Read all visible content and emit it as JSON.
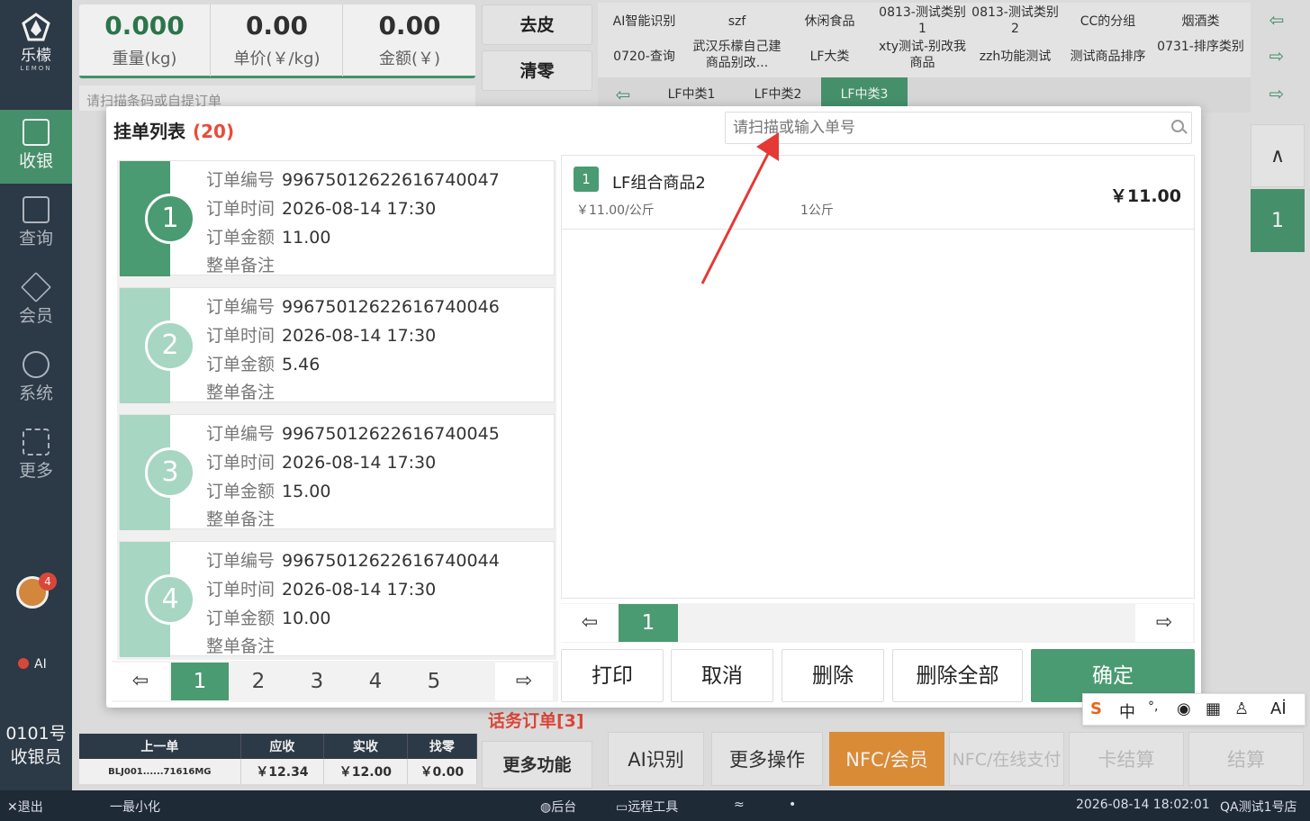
{
  "sidebar": {
    "logo_cn": "乐檬",
    "logo_en": "LEMON",
    "items": [
      {
        "label": "收银",
        "icon": "register-icon"
      },
      {
        "label": "查询",
        "icon": "search-doc-icon"
      },
      {
        "label": "会员",
        "icon": "diamond-icon"
      },
      {
        "label": "系统",
        "icon": "gear-icon"
      },
      {
        "label": "更多",
        "icon": "grid-icon"
      }
    ],
    "notification_count": "4",
    "ai_label": "AI",
    "cashier_line1": "0101号",
    "cashier_line2": "收银员"
  },
  "scale": {
    "weight_value": "0.000",
    "weight_label": "重量(kg)",
    "unit_price_value": "0.00",
    "unit_price_label": "单价(￥/kg)",
    "amount_value": "0.00",
    "amount_label": "金额(￥)"
  },
  "scan_hint": "请扫描条码或自提订单",
  "tools": {
    "tare": "去皮",
    "zero": "清零"
  },
  "categories": {
    "row1": [
      "AI智能识别",
      "szf",
      "休闲食品",
      "0813-测试类别1",
      "0813-测试类别2",
      "CC的分组",
      "烟酒类"
    ],
    "row2": [
      "0720-查询",
      "武汉乐檬自己建商品别改...",
      "LF大类",
      "xty测试-别改我商品",
      "zzh功能测试",
      "测试商品排序",
      "0731-排序类别"
    ],
    "sub": [
      "LF中类1",
      "LF中类2",
      "LF中类3"
    ],
    "active_sub": "LF中类3"
  },
  "right_page": "1",
  "modal": {
    "title": "挂单列表",
    "count": "(20)",
    "search_placeholder": "请扫描或输入单号",
    "labels": {
      "order_no": "订单编号",
      "order_time": "订单时间",
      "order_amount": "订单金额",
      "remark": "整单备注"
    },
    "orders": [
      {
        "index": "1",
        "no": "99675012622616740047",
        "time": "2026-08-14 17:30",
        "amount": "11.00"
      },
      {
        "index": "2",
        "no": "99675012622616740046",
        "time": "2026-08-14 17:30",
        "amount": "5.46"
      },
      {
        "index": "3",
        "no": "99675012622616740045",
        "time": "2026-08-14 17:30",
        "amount": "15.00"
      },
      {
        "index": "4",
        "no": "99675012622616740044",
        "time": "2026-08-14 17:30",
        "amount": "10.00"
      }
    ],
    "pages": [
      "1",
      "2",
      "3",
      "4",
      "5"
    ],
    "detail": {
      "index": "1",
      "name": "LF组合商品2",
      "unit_price": "￥11.00/公斤",
      "qty": "1公斤",
      "total": "￥11.00",
      "page": "1"
    },
    "actions": {
      "print": "打印",
      "cancel": "取消",
      "delete": "删除",
      "delete_all": "删除全部",
      "confirm": "确定"
    }
  },
  "summary": {
    "headers": [
      "上一单",
      "应收",
      "实收",
      "找零"
    ],
    "values": [
      "BLJ001......71616MG",
      "￥12.34",
      "￥12.00",
      "￥0.00"
    ]
  },
  "bottom": {
    "hw_orders": "话务订单[3]",
    "more_functions": "更多功能",
    "ai_recognize": "AI识别",
    "more_ops": "更多操作",
    "nfc_member": "NFC/会员",
    "nfc_online": "NFC/在线支付",
    "card_settle": "卡结算",
    "settle": "结算"
  },
  "statusbar": {
    "exit": "退出",
    "minimize": "一最小化",
    "backend": "后台",
    "remote": "远程工具",
    "datetime": "2026-08-14 18:02:01",
    "store": "QA测试1号店"
  },
  "ime": {
    "lang": "中",
    "punct": "°,",
    "ai": "Aİ"
  },
  "colors": {
    "accent": "#4a9a72",
    "sidebar": "#2f3d4b",
    "orange": "#e8943a",
    "red": "#e74c3c"
  }
}
